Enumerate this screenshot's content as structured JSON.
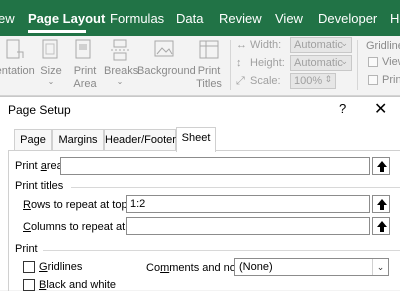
{
  "ribbon": {
    "tabs": [
      {
        "label": "ew"
      },
      {
        "label": "Page Layout"
      },
      {
        "label": "Formulas"
      },
      {
        "label": "Data"
      },
      {
        "label": "Review"
      },
      {
        "label": "View"
      },
      {
        "label": "Developer"
      },
      {
        "label": "He"
      }
    ],
    "page_setup_group": {
      "orientation": "ientation",
      "size": "Size",
      "print_area_line1": "Print",
      "print_area_line2": "Area",
      "breaks": "Breaks",
      "background": "Background",
      "print_titles_line1": "Print",
      "print_titles_line2": "Titles"
    },
    "scale_to_fit": {
      "width_label": "Width:",
      "width_value": "Automatic",
      "height_label": "Height:",
      "height_value": "Automatic",
      "scale_label": "Scale:",
      "scale_value": "100%"
    },
    "sheet_options": {
      "gridlines": "Gridline",
      "view": "View",
      "print": "Prin"
    }
  },
  "dialog": {
    "title": "Page Setup",
    "help": "?",
    "close": "✕",
    "tabs": [
      {
        "label": "Page"
      },
      {
        "label": "Margins"
      },
      {
        "label": "Header/Footer"
      },
      {
        "label": "Sheet"
      }
    ],
    "print_area": {
      "label_pre": "Print ",
      "label_key": "a",
      "label_post": "rea:",
      "value": ""
    },
    "print_titles_heading": "Print titles",
    "rows_to_repeat": {
      "label_key": "R",
      "label_post": "ows to repeat at top:",
      "value": "1:2"
    },
    "columns_to_repeat": {
      "label_key": "C",
      "label_post": "olumns to repeat at left:",
      "value": ""
    },
    "print_heading": "Print",
    "gridlines": {
      "label_key": "G",
      "label_post": "ridlines"
    },
    "black_and_white": {
      "label_key": "B",
      "label_post": "lack and white"
    },
    "comments": {
      "label_pre": "Co",
      "label_key": "m",
      "label_post": "ments and notes:",
      "value": "(None)"
    }
  }
}
